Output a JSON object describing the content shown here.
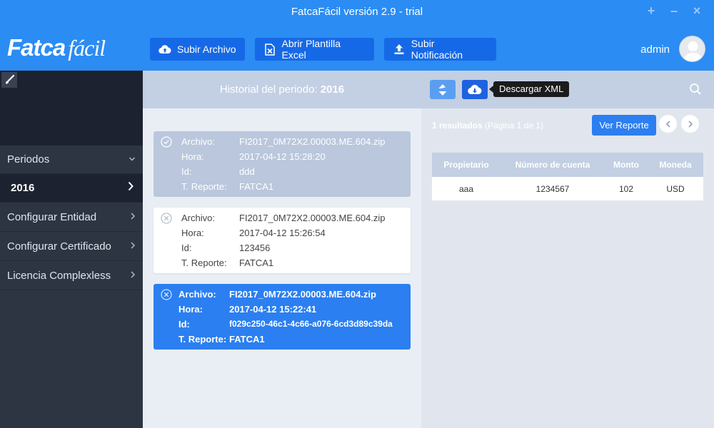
{
  "window": {
    "title": "FatcaFácil versión 2.9 - trial",
    "controls": [
      "+",
      "–",
      "×"
    ]
  },
  "header": {
    "logo_bold": "Fatca",
    "logo_light": "fácil",
    "buttons": [
      {
        "label": "Subir Archivo",
        "icon": "cloud-upload-icon"
      },
      {
        "label": "Abrir Plantilla Excel",
        "icon": "excel-file-icon"
      },
      {
        "label": "Subir Notificación",
        "icon": "upload-icon"
      }
    ],
    "user": "admin"
  },
  "sidebar": {
    "items": [
      {
        "label": "Periodos",
        "chevron": "⌄"
      },
      {
        "label": "2016",
        "chevron": "›"
      },
      {
        "label": "Configurar Entidad",
        "chevron": "›"
      },
      {
        "label": "Configurar Certificado",
        "chevron": "›"
      },
      {
        "label": "Licencia Complexless",
        "chevron": "›"
      }
    ]
  },
  "history": {
    "title_prefix": "Historial del periodo: ",
    "title_year": "2016",
    "field_labels": {
      "archivo": "Archivo:",
      "hora": "Hora:",
      "id": "Id:",
      "reporte": "T. Reporte:"
    },
    "cards": [
      {
        "archivo": "FI2017_0M72X2.00003.ME.604.zip",
        "hora": "2017-04-12 15:28:20",
        "id": "ddd",
        "reporte": "FATCA1",
        "status_icon": "check-circle-icon"
      },
      {
        "archivo": "FI2017_0M72X2.00003.ME.604.zip",
        "hora": "2017-04-12 15:26:54",
        "id": "123456",
        "reporte": "FATCA1",
        "status_icon": "x-circle-icon"
      },
      {
        "archivo": "FI2017_0M72X2.00003.ME.604.zip",
        "hora": "2017-04-12 15:22:41",
        "id": "f029c250-46c1-4c66-a076-6cd3d89c39da",
        "reporte": "FATCA1",
        "status_icon": "x-circle-icon"
      }
    ]
  },
  "results_panel": {
    "tooltip": "Descargar XML",
    "results_count": "1 resultados",
    "results_page": "(Página 1 de 1)",
    "report_button": "Ver Reporte",
    "table": {
      "headers": [
        "Propietario",
        "Número de cuenta",
        "Monto",
        "Moneda"
      ],
      "rows": [
        [
          "aaa",
          "1234567",
          "102",
          "USD"
        ]
      ]
    }
  },
  "colors": {
    "brand_blue": "#2b8cf3",
    "button_blue": "#1669e6",
    "sidebar_dark": "#2e3542",
    "panel_header": "#c3cfe3"
  }
}
